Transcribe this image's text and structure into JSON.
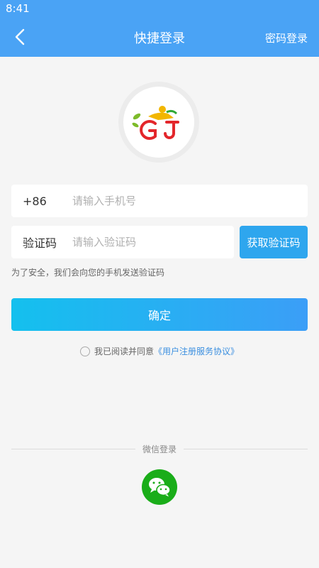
{
  "status_bar": {
    "time": "8:41"
  },
  "header": {
    "title": "快捷登录",
    "right_action": "密码登录"
  },
  "form": {
    "phone": {
      "prefix": "+86",
      "placeholder": "请输入手机号",
      "value": ""
    },
    "code": {
      "prefix": "验证码",
      "placeholder": "请输入验证码",
      "value": ""
    },
    "get_code_label": "获取验证码",
    "hint": "为了安全，我们会向您的手机发送验证码",
    "confirm_label": "确定"
  },
  "agreement": {
    "text": "我已阅读并同意",
    "link": "《用户注册服务协议》",
    "checked": false
  },
  "social": {
    "divider_label": "微信登录"
  },
  "colors": {
    "header_bg": "#4aa3f5",
    "accent": "#2ea6ee",
    "wechat": "#1aad19"
  }
}
